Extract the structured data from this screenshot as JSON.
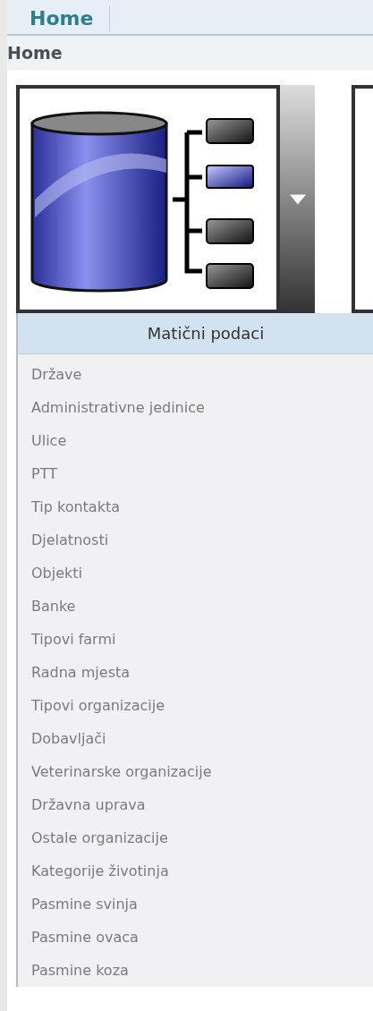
{
  "top_nav": {
    "tabs": [
      {
        "label": "Home",
        "selected": true
      }
    ]
  },
  "breadcrumb": "Home",
  "tiles": [
    {
      "kind": "database"
    },
    {
      "kind": "blank"
    }
  ],
  "menu": {
    "expanded": true,
    "title": "Matični podaci",
    "items": [
      "Države",
      "Administrativne jedinice",
      "Ulice",
      "PTT",
      "Tip kontakta",
      "Djelatnosti",
      "Objekti",
      "Banke",
      "Tipovi farmi",
      "Radna mjesta",
      "Tipovi organizacije",
      "Dobavljači",
      "Veterinarske organizacije",
      "Državna uprava",
      "Ostale organizacije",
      "Kategorije životinja",
      "Pasmine svinja",
      "Pasmine ovaca",
      "Pasmine koza"
    ]
  }
}
